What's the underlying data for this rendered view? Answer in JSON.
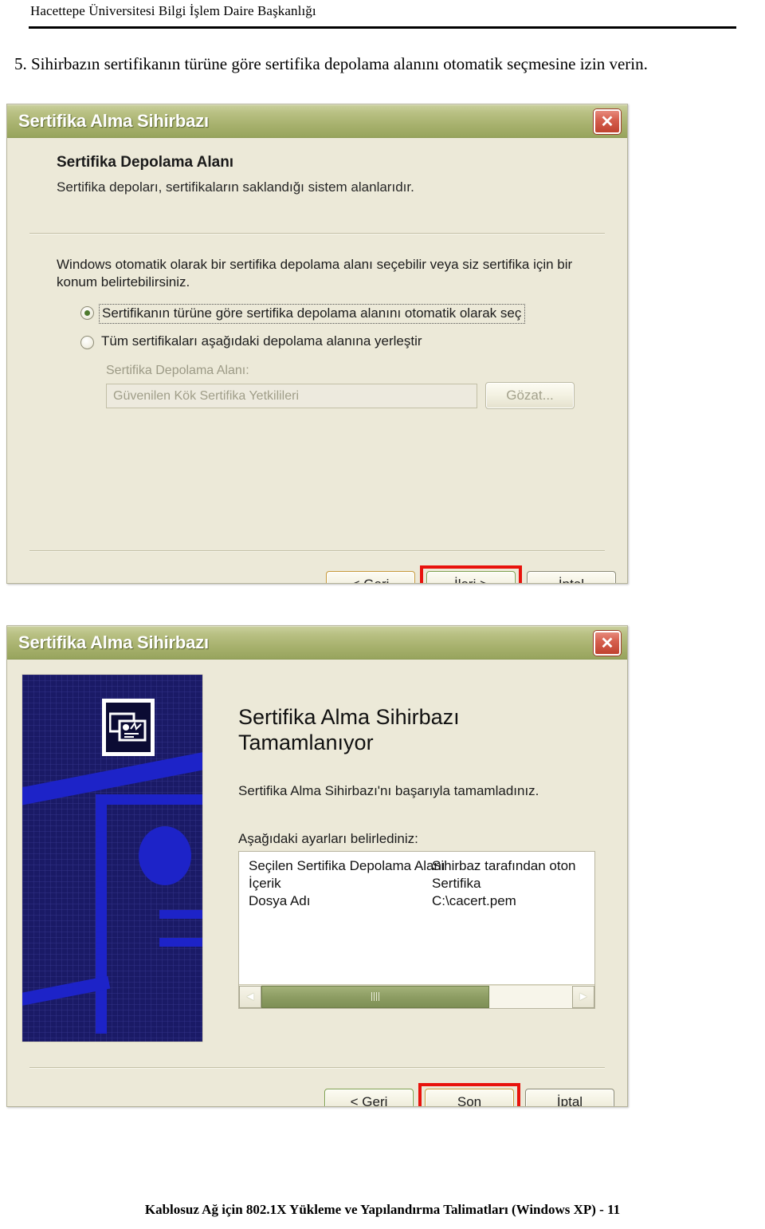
{
  "document": {
    "header": "Hacettepe Üniversitesi Bilgi İşlem Daire Başkanlığı",
    "step_text": "5. Sihirbazın sertifikanın türüne göre sertifika depolama alanını otomatik seçmesine izin verin.",
    "footer": "Kablosuz Ağ için 802.1X Yükleme ve Yapılandırma Talimatları (Windows XP) - 11"
  },
  "theme": {
    "titlebar_green": "#a7b16d",
    "dialog_face": "#ece9d8",
    "highlight_red": "#e8120c",
    "watermark_navy": "#1a1a66",
    "watermark_blue": "#1d23c8",
    "scrollbar_green": "#8d9d63"
  },
  "dialog1": {
    "title": "Sertifika Alma Sihirbazı",
    "close_glyph": "✕",
    "page_title": "Sertifika Depolama Alanı",
    "page_subtitle": "Sertifika depoları, sertifikaların saklandığı sistem alanlarıdır.",
    "paragraph": "Windows otomatik olarak bir sertifika depolama alanı seçebilir veya siz sertifika için bir konum belirtebilirsiniz.",
    "radio_auto": {
      "label": "Sertifikanın türüne göre sertifika depolama alanını otomatik olarak seç",
      "accesskey": "S",
      "selected": "true"
    },
    "radio_manual": {
      "label": "Tüm sertifikaları aşağıdaki depolama alanına yerleştir",
      "accesskey": "T",
      "selected": "false"
    },
    "store_label": "Sertifika Depolama Alanı:",
    "store_value": "Güvenilen Kök Sertifika Yetkilileri",
    "browse_button": "Gözat...",
    "buttons": {
      "back": "< Geri",
      "next": "İleri >",
      "cancel": "İptal"
    },
    "highlighted_button": "İleri >"
  },
  "dialog2": {
    "title": "Sertifika Alma Sihirbazı",
    "close_glyph": "✕",
    "heading_line1": "Sertifika Alma Sihirbazı",
    "heading_line2": "Tamamlanıyor",
    "success_text": "Sertifika Alma Sihirbazı'nı başarıyla tamamladınız.",
    "settings_intro": "Aşağıdaki ayarları belirlediniz:",
    "settings_rows": [
      {
        "key": "Seçilen Sertifika Depolama Alanı",
        "value": "Sihirbaz tarafından oton"
      },
      {
        "key": "İçerik",
        "value": "Sertifika"
      },
      {
        "key": "Dosya Adı",
        "value": "C:\\cacert.pem"
      }
    ],
    "scrollbar": {
      "left_glyph": "◄",
      "right_glyph": "►"
    },
    "buttons": {
      "back": "< Geri",
      "finish": "Son",
      "cancel": "İptal"
    },
    "highlighted_button": "Son"
  }
}
